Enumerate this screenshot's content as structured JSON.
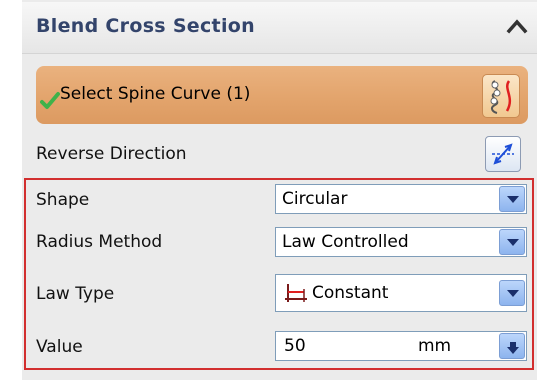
{
  "section": {
    "title": "Blend Cross Section"
  },
  "spine": {
    "label": "Select Spine Curve (1)"
  },
  "reverse": {
    "label": "Reverse Direction"
  },
  "fields": {
    "shape": {
      "label": "Shape",
      "value": "Circular"
    },
    "radius_method": {
      "label": "Radius Method",
      "value": "Law Controlled"
    },
    "law_type": {
      "label": "Law Type",
      "value": "Constant"
    },
    "value": {
      "label": "Value",
      "value": "50",
      "unit": "mm"
    }
  },
  "colors": {
    "header_title": "#33446b",
    "highlight_row": "#e2a36b",
    "group_border": "#d22f2f",
    "dropdown_blue": "#8db4ee",
    "check_green": "#3fb24a"
  },
  "icons": {
    "collapse": "chevron-up-icon",
    "check": "check-icon",
    "spine_curve": "spine-curve-icon",
    "reverse_direction": "reverse-direction-icon",
    "law_constant": "law-constant-icon",
    "dropdown": "dropdown-arrow-icon"
  }
}
